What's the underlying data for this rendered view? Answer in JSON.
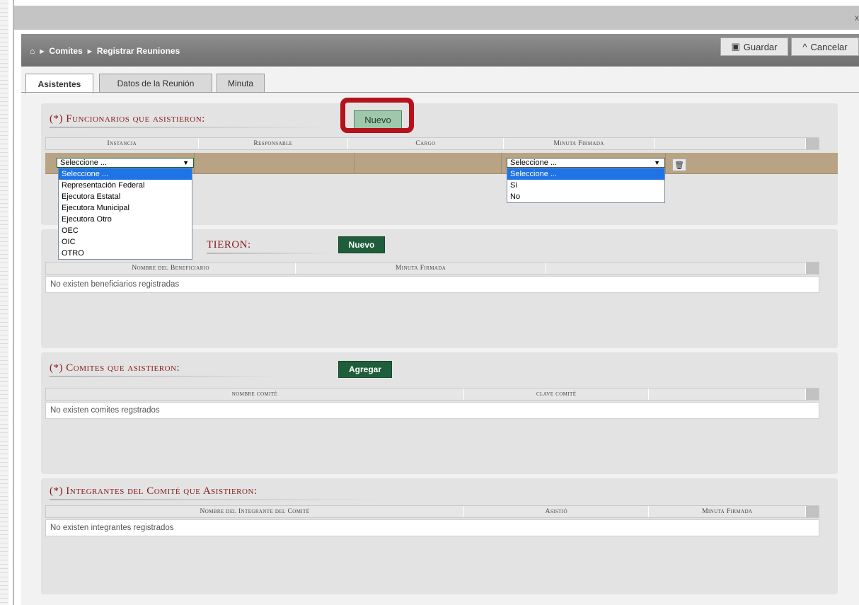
{
  "window": {
    "close_fragment": "x"
  },
  "breadcrumb": {
    "home_icon": "home-icon",
    "items": [
      "Comites",
      "Registrar Reuniones"
    ]
  },
  "toolbar": {
    "save_label": "Guardar",
    "cancel_label": "Cancelar"
  },
  "tabs": [
    {
      "label": "Asistentes",
      "active": true
    },
    {
      "label": "Datos de la Reunión",
      "active": false
    },
    {
      "label": "Minuta",
      "active": false
    }
  ],
  "funcionarios": {
    "title": "(*) Funcionarios que asistieron:",
    "button": "Nuevo",
    "columns": [
      "Instancia",
      "Responsable",
      "Cargo",
      "Minuta Firmada"
    ],
    "instancia_select": {
      "value": "Seleccione ...",
      "options": [
        "Seleccione ...",
        "Representación Federal",
        "Ejecutora Estatal",
        "Ejecutora Municipal",
        "Ejecutora Otro",
        "OEC",
        "OIC",
        "OTRO"
      ]
    },
    "minuta_select": {
      "value": "Seleccione ...",
      "options": [
        "Seleccione ...",
        "Si",
        "No"
      ]
    }
  },
  "beneficiarios": {
    "title_visible": "TIERON:",
    "button": "Nuevo",
    "columns": [
      "Nombre del Beneficiario",
      "Minuta Firmada"
    ],
    "empty": "No existen beneficiarios registradas"
  },
  "comites": {
    "title": "(*) Comites que asistieron:",
    "button": "Agregar",
    "columns": [
      "nombre comité",
      "clave comité"
    ],
    "empty": "No existen comites regstrados"
  },
  "integrantes": {
    "title": "(*) Integrantes del Comité que Asistieron:",
    "columns": [
      "Nombre del Integrante del Comité",
      "Asistió",
      "Minuta Firmada"
    ],
    "empty": "No existen integrantes registrados"
  },
  "colors": {
    "accent_green": "#1f5e3a",
    "title_red": "#8b1a1a",
    "highlight_red": "#b5121b",
    "edit_row": "#b8a485"
  }
}
